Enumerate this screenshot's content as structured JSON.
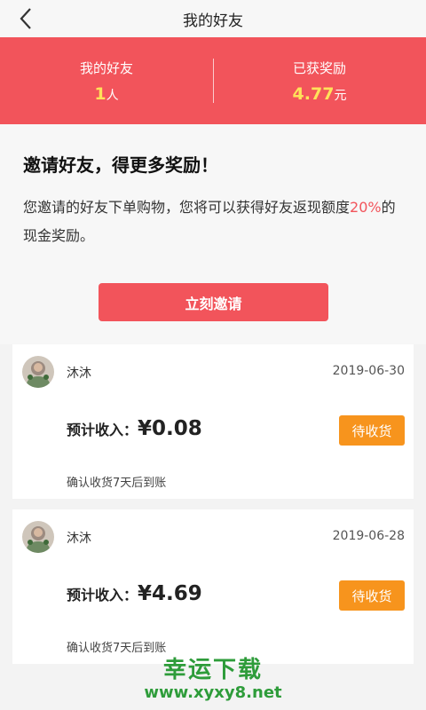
{
  "header": {
    "title": "我的好友",
    "back_icon": "chevron-left-icon"
  },
  "stats": {
    "friends": {
      "label": "我的好友",
      "value": "1",
      "unit": "人"
    },
    "rewards": {
      "label": "已获奖励",
      "value": "4.77",
      "unit": "元"
    }
  },
  "invite": {
    "heading": "邀请好友，得更多奖励！",
    "desc_before": "您邀请的好友下单购物，您将可以获得好友返现额度",
    "desc_pct": "20%",
    "desc_after": "的现金奖励。",
    "button_label": "立刻邀请"
  },
  "records": [
    {
      "name": "沐沐",
      "date": "2019-06-30",
      "income_label": "预计收入：",
      "amount": "¥0.08",
      "status": "待收货",
      "note": "确认收货7天后到账"
    },
    {
      "name": "沐沐",
      "date": "2019-06-28",
      "income_label": "预计收入：",
      "amount": "¥4.69",
      "status": "待收货",
      "note": "确认收货7天后到账"
    }
  ],
  "watermark": {
    "line1": "幸运下载",
    "line2": "www.xyxy8.net"
  },
  "colors": {
    "brand_red": "#f2545b",
    "highlight_yellow": "#ffe25a",
    "status_orange": "#f7941d",
    "watermark_green": "#2e9c3a"
  }
}
